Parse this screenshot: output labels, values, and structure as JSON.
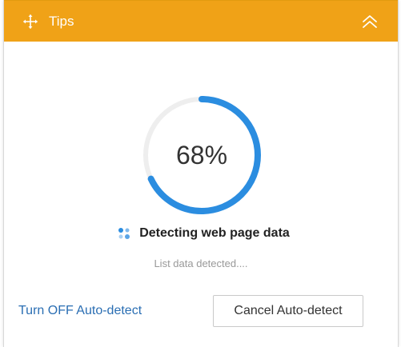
{
  "header": {
    "title": "Tips",
    "move_icon": "move-arrows-icon",
    "collapse_icon": "double-chevron-up-icon",
    "color": "#f0a217"
  },
  "progress": {
    "percent": 68,
    "label": "68%",
    "color": "#2b8de0",
    "track_color": "#eeeeee"
  },
  "status": {
    "icon": "detecting-dots-icon",
    "text": "Detecting web page data",
    "subtext": "List data detected...."
  },
  "actions": {
    "turn_off_label": "Turn OFF Auto-detect",
    "cancel_label": "Cancel Auto-detect"
  }
}
